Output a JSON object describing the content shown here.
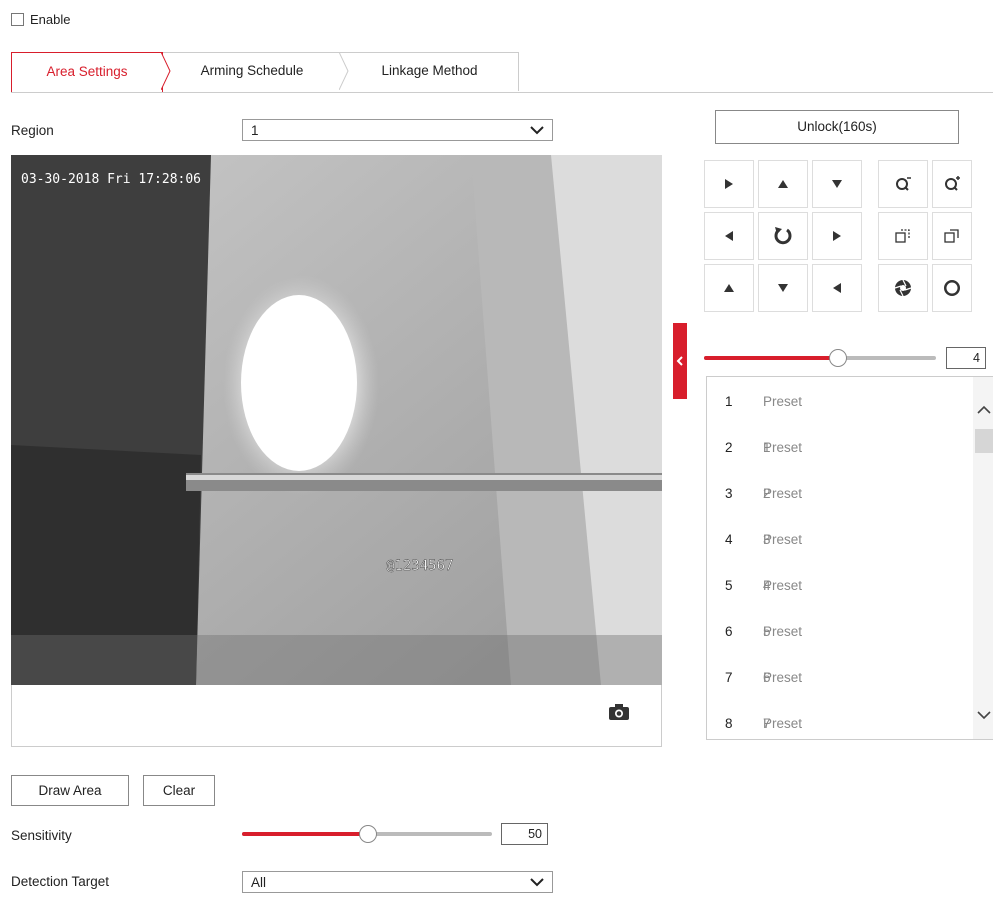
{
  "enable": {
    "label": "Enable",
    "checked": false
  },
  "tabs": [
    {
      "label": "Area Settings",
      "active": true
    },
    {
      "label": "Arming Schedule",
      "active": false
    },
    {
      "label": "Linkage Method",
      "active": false
    }
  ],
  "region": {
    "label": "Region",
    "value": "1"
  },
  "video": {
    "timestamp": "03-30-2018 Fri 17:28:06",
    "overlay_text": "@1234567"
  },
  "ptz": {
    "unlock_label": "Unlock(160s)",
    "speed_value": "4",
    "speed_level": 4,
    "speed_max": 7,
    "icons": {
      "up_left": "arrow-up-left-icon",
      "up": "arrow-up-icon",
      "up_right": "arrow-up-right-icon",
      "left": "arrow-left-icon",
      "auto": "rotate-icon",
      "right": "arrow-right-icon",
      "down_left": "arrow-down-left-icon",
      "down": "arrow-down-icon",
      "down_right": "arrow-down-right-icon",
      "zoom_out": "zoom-out-icon",
      "zoom_in": "zoom-in-icon",
      "focus_near": "focus-near-icon",
      "focus_far": "focus-far-icon",
      "iris_close": "iris-close-icon",
      "iris_open": "iris-open-icon"
    }
  },
  "presets": [
    {
      "num": "1",
      "name": "Preset 1"
    },
    {
      "num": "2",
      "name": "Preset 2"
    },
    {
      "num": "3",
      "name": "Preset 3"
    },
    {
      "num": "4",
      "name": "Preset 4"
    },
    {
      "num": "5",
      "name": "Preset 5"
    },
    {
      "num": "6",
      "name": "Preset 6"
    },
    {
      "num": "7",
      "name": "Preset 7"
    },
    {
      "num": "8",
      "name": "Preset 8"
    }
  ],
  "buttons": {
    "draw_area": "Draw Area",
    "clear": "Clear"
  },
  "sensitivity": {
    "label": "Sensitivity",
    "value": "50",
    "level": 50,
    "max": 100
  },
  "detection_target": {
    "label": "Detection Target",
    "value": "All"
  },
  "colors": {
    "accent": "#d81e2c",
    "border": "#cccccc"
  }
}
